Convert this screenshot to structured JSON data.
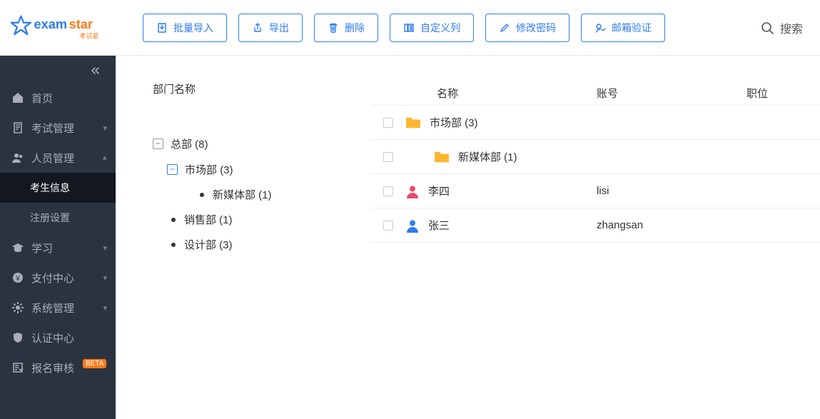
{
  "logo": {
    "brand": "examstar",
    "suffix": "考试星"
  },
  "toolbar": {
    "batch_import": "批量导入",
    "export": "导出",
    "delete": "删除",
    "custom_cols": "自定义列",
    "change_pw": "修改密码",
    "email_verify": "邮箱验证",
    "search_placeholder": "搜索"
  },
  "sidebar": {
    "home": "首页",
    "exam_mgmt": "考试管理",
    "people_mgmt": "人员管理",
    "candidate_info": "考生信息",
    "register_settings": "注册设置",
    "learning": "学习",
    "payment": "支付中心",
    "sys_mgmt": "系统管理",
    "auth_center": "认证中心",
    "signup_review": "报名审核",
    "beta": "BETA"
  },
  "dept": {
    "title": "部门名称",
    "root": "总部 (8)",
    "market": "市场部 (3)",
    "newmedia": "新媒体部 (1)",
    "sales": "销售部 (1)",
    "design": "设计部 (3)"
  },
  "table": {
    "headers": {
      "name": "名称",
      "account": "账号",
      "position": "职位"
    },
    "rows": [
      {
        "type": "folder",
        "name": "市场部 (3)",
        "account": "",
        "indent": 0
      },
      {
        "type": "folder",
        "name": "新媒体部 (1)",
        "account": "",
        "indent": 1
      },
      {
        "type": "person",
        "name": "李四",
        "account": "lisi",
        "color": "#e94b6e",
        "indent": 0
      },
      {
        "type": "person",
        "name": "张三",
        "account": "zhangsan",
        "color": "#2e7cee",
        "indent": 0
      }
    ]
  }
}
